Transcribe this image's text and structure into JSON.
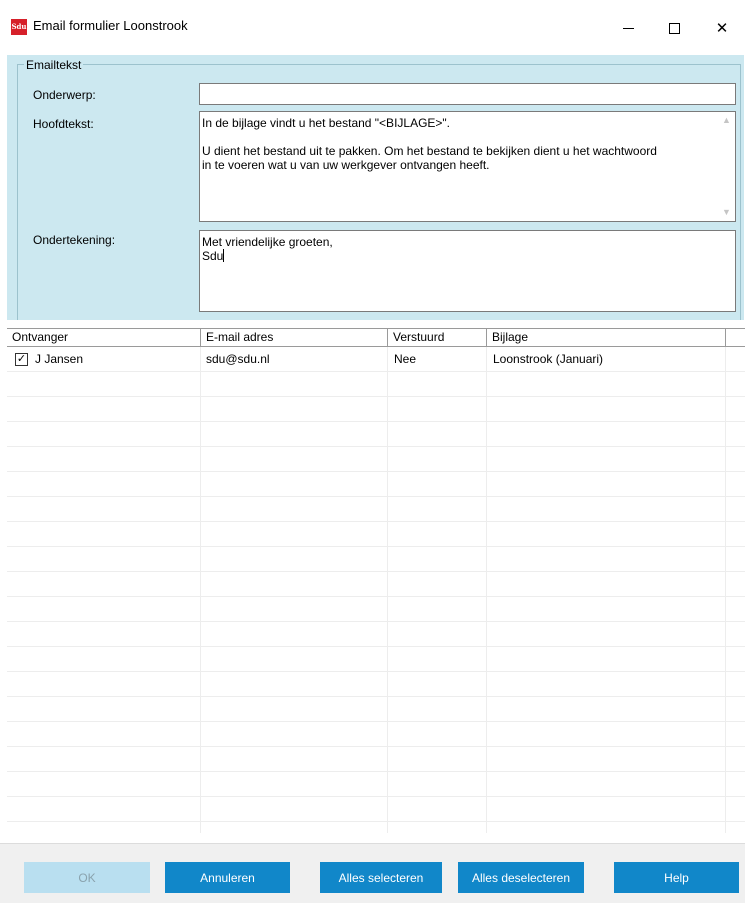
{
  "window": {
    "app_icon_text": "Sdu",
    "title": "Email formulier  Loonstrook",
    "minimize_symbol": "",
    "maximize_symbol": "",
    "close_symbol": "✕"
  },
  "emailtekst": {
    "legend": "Emailtekst",
    "onderwerp_label": "Onderwerp:",
    "onderwerp_value": "",
    "hoofdtekst_label": "Hoofdtekst:",
    "hoofdtekst_value": "In de bijlage vindt u het bestand \"<BIJLAGE>\".\n\nU dient het bestand uit te pakken. Om het bestand te bekijken dient u het wachtwoord\nin te voeren wat u van uw werkgever ontvangen heeft.",
    "ondertekening_label": "Ondertekening:",
    "ondertekening_value": "Met vriendelijke groeten,\nSdu"
  },
  "grid": {
    "columns": [
      "Ontvanger",
      "E-mail adres",
      "Verstuurd",
      "Bijlage"
    ],
    "rows": [
      {
        "checked": true,
        "ontvanger": "J Jansen",
        "email": "sdu@sdu.nl",
        "verstuurd": "Nee",
        "bijlage": "Loonstrook (Januari)"
      }
    ]
  },
  "buttons": {
    "ok": "OK",
    "annuleren": "Annuleren",
    "alles_selecteren": "Alles selecteren",
    "alles_deselecteren": "Alles deselecteren",
    "help": "Help"
  },
  "colors": {
    "panel_bg": "#cce8f0",
    "button_bg": "#1187c9",
    "button_disabled_bg": "#b9dff0",
    "app_icon_bg": "#d6202a"
  }
}
